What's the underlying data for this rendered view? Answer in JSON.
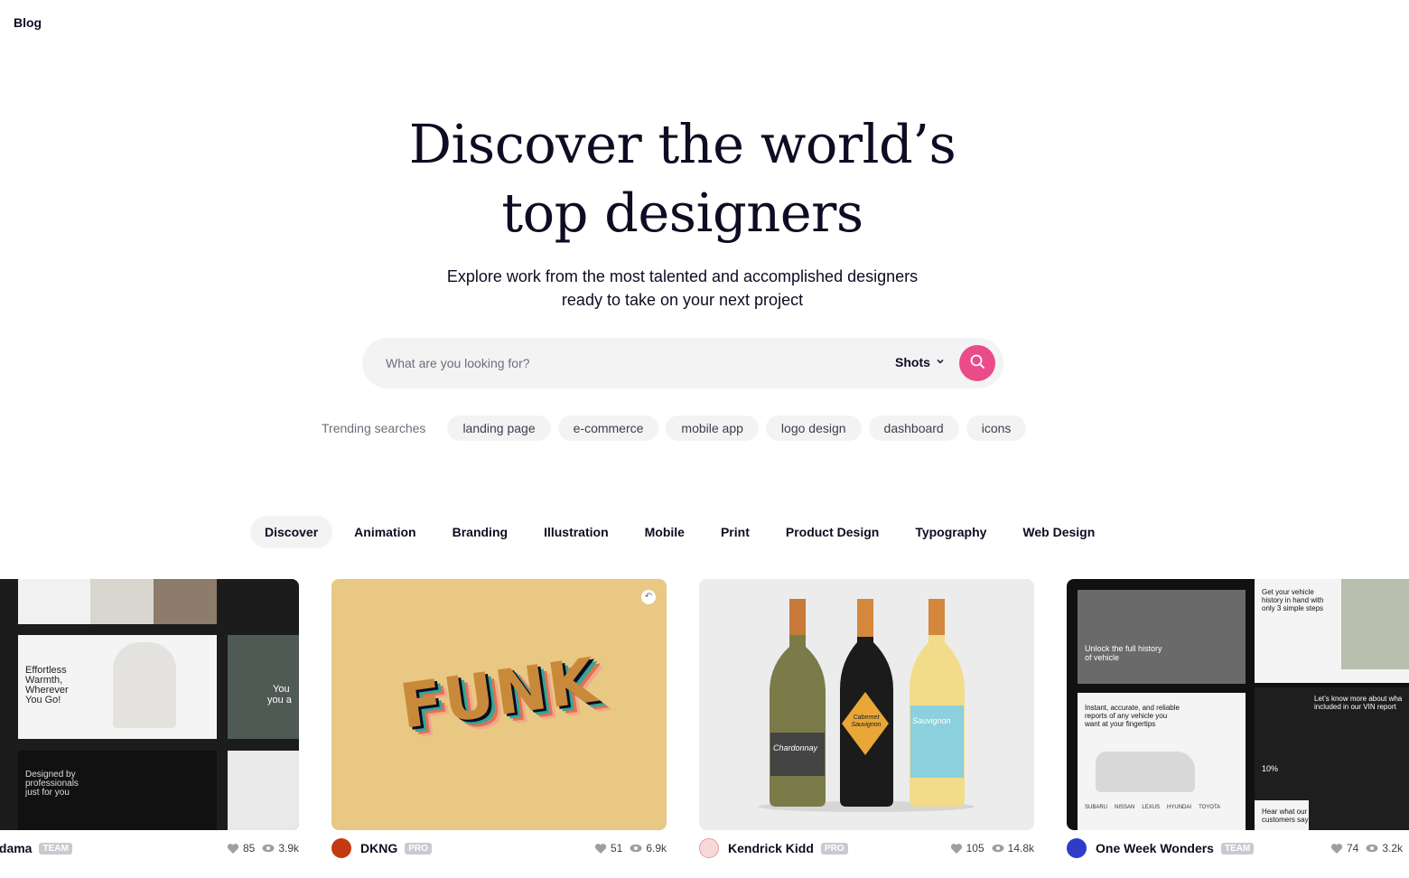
{
  "nav": {
    "blog": "Blog"
  },
  "hero": {
    "title_line1": "Discover the world’s",
    "title_line2": "top designers",
    "subtitle_line1": "Explore work from the most talented and accomplished designers",
    "subtitle_line2": "ready to take on your next project"
  },
  "search": {
    "placeholder": "What are you looking for?",
    "type": "Shots",
    "accent": "#ea4c89"
  },
  "trending": {
    "label": "Trending searches",
    "items": [
      "landing page",
      "e-commerce",
      "mobile app",
      "logo design",
      "dashboard",
      "icons"
    ]
  },
  "categories": [
    "Discover",
    "Animation",
    "Branding",
    "Illustration",
    "Mobile",
    "Print",
    "Product Design",
    "Typography",
    "Web Design"
  ],
  "shots": [
    {
      "author": "Odama",
      "badge": "TEAM",
      "likes": "85",
      "views": "3.9k",
      "texts": [
        "Effortless Warmth, Wherever You Go!",
        "Designed by professionals just for you",
        "You",
        "you a"
      ]
    },
    {
      "author": "DKNG",
      "badge": "PRO",
      "likes": "51",
      "views": "6.9k",
      "texts": [
        "FUNK"
      ],
      "bg": "#e8c883"
    },
    {
      "author": "Kendrick Kidd",
      "badge": "PRO",
      "likes": "105",
      "views": "14.8k",
      "texts": [
        "Chardonnay",
        "Cabernet Sauvignon",
        "Sauvignon"
      ]
    },
    {
      "author": "One Week Wonders",
      "badge": "TEAM",
      "likes": "74",
      "views": "3.2k",
      "texts": [
        "Unlock the full history of vehicle",
        "Get your vehicle history in hand with only 3 simple steps",
        "Instant, accurate, and reliable reports of any vehicle you want at your fingertips",
        "Let’s know more about wha included in our VIN report",
        "10%",
        "Hear what our customers say",
        "SUBARU",
        "NISSAN",
        "LEXUS",
        "HYUNDAI",
        "TOYOTA"
      ]
    }
  ]
}
